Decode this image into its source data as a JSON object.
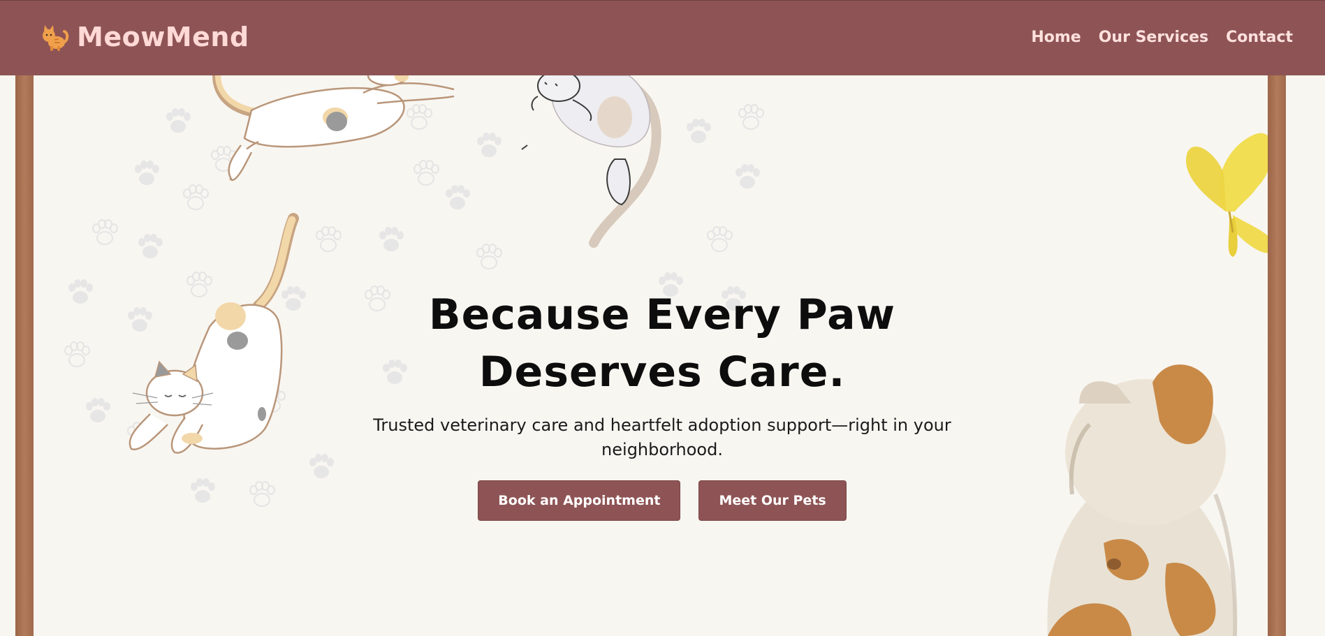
{
  "brand": {
    "name": "MeowMend",
    "icon": "cat-icon"
  },
  "nav": {
    "items": [
      "Home",
      "Our Services",
      "Contact"
    ]
  },
  "hero": {
    "title": "Because Every Paw Deserves Care.",
    "subtitle": "Trusted veterinary care and heartfelt adoption support—right in your neighborhood.",
    "buttons": {
      "primary": "Book an Appointment",
      "secondary": "Meet Our Pets"
    }
  },
  "colors": {
    "header_bg": "#8e5455",
    "brand_text": "#ffd9d6",
    "button_bg": "#8e5455",
    "page_bg": "#f8f6f1",
    "frame_post": "#b27b5a"
  },
  "illustrations": [
    "leaping-cat",
    "hanging-cat",
    "stretching-cat",
    "butterfly",
    "sitting-calico-cat",
    "paw-print-pattern"
  ]
}
